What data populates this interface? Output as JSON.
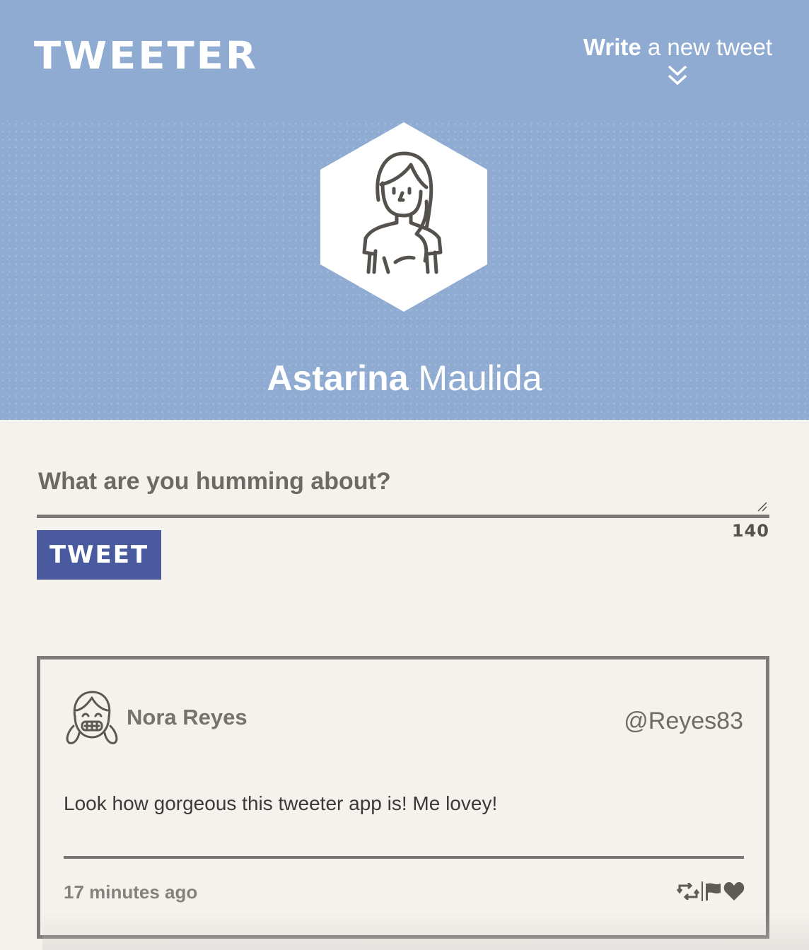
{
  "header": {
    "logo": "TWEETER",
    "write_new": {
      "bold": "Write",
      "rest": " a new tweet"
    },
    "chevron_icon": "double-chevron-down-icon",
    "background_color": "#8fabd2"
  },
  "profile": {
    "first_name": "Astarina",
    "last_name": " Maulida",
    "avatar_icon": "woman-avatar-icon"
  },
  "compose": {
    "placeholder": "What are you humming about?",
    "value": "",
    "counter": "140",
    "button_label": "TWEET",
    "button_color": "#4a5a9e"
  },
  "tweets": [
    {
      "name": "Nora Reyes",
      "handle": "@Reyes83",
      "body": "Look how gorgeous this tweeter app is! Me lovey!",
      "time": "17 minutes ago",
      "avatar_icon": "girl-avatar-icon",
      "actions": [
        "retweet-icon",
        "flag-icon",
        "heart-icon"
      ]
    }
  ]
}
